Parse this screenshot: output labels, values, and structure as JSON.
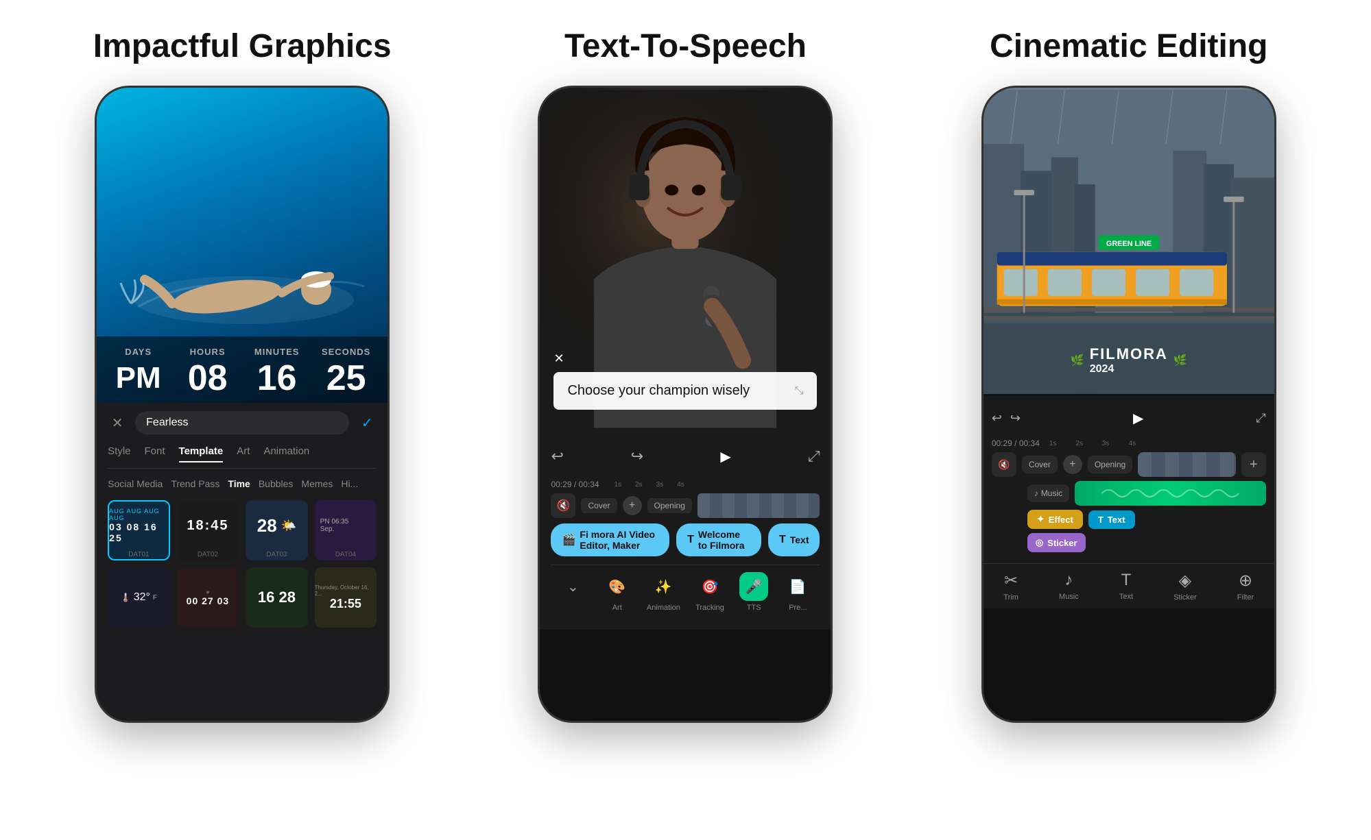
{
  "section1": {
    "title": "Impactful Graphics",
    "timer": {
      "labels": [
        "DAYS",
        "HOURS",
        "MINUTES",
        "SECONDS"
      ],
      "values": [
        "PM",
        "08",
        "16",
        "25"
      ]
    },
    "panel": {
      "preset_name": "Fearless",
      "tabs": [
        "Style",
        "Font",
        "Template",
        "Art",
        "Animation"
      ],
      "active_tab": "Template",
      "filters": [
        "Social Media",
        "Trend Pass",
        "Time",
        "Bubbles",
        "Memes",
        "Hi..."
      ],
      "active_filter": "Time",
      "templates": [
        {
          "id": "DAT01",
          "nums": "03 08 16 25"
        },
        {
          "id": "DAT02",
          "nums": "18:45"
        },
        {
          "id": "DAT03",
          "nums": "28"
        },
        {
          "id": "DAT04",
          "nums": "PN 06:35\nSep."
        },
        {
          "id": "T05",
          "nums": "32°"
        },
        {
          "id": "T06",
          "nums": "00 27 03"
        },
        {
          "id": "T07",
          "nums": "16 28"
        },
        {
          "id": "T08",
          "nums": "21:55"
        }
      ]
    }
  },
  "section2": {
    "title": "Text-To-Speech",
    "caption": "Choose your champion wisely",
    "time": "00:29 / 00:34",
    "ruler": [
      "1s",
      "2s",
      "3s",
      "4s"
    ],
    "pills": [
      {
        "label": "Fi mora AI Video Editor, Maker",
        "icon": "🎬"
      },
      {
        "label": "Welcome to Filmora",
        "icon": "T"
      },
      {
        "label": "Text",
        "icon": "T"
      }
    ],
    "toolbar": [
      "Art",
      "Animation",
      "Tracking",
      "TTS",
      "Pre..."
    ],
    "toolbar_icons": [
      "🎨",
      "✨",
      "🎯",
      "🎤",
      "📄"
    ]
  },
  "section3": {
    "title": "Cinematic Editing",
    "badge_main": "FILMORA",
    "badge_year": "2024",
    "time": "00:29 / 00:34",
    "ruler": [
      "1s",
      "2s",
      "3s",
      "4s"
    ],
    "tracks": [
      {
        "name": "Cover",
        "type": "video"
      },
      {
        "name": "Opening",
        "type": "video"
      },
      {
        "name": "Music",
        "type": "music"
      },
      {
        "name": "Effect",
        "type": "effect"
      },
      {
        "name": "Text",
        "type": "text"
      },
      {
        "name": "Sticker",
        "type": "sticker"
      }
    ],
    "toolbar": [
      "Trim",
      "Music",
      "Text",
      "Sticker",
      "Filter"
    ]
  }
}
